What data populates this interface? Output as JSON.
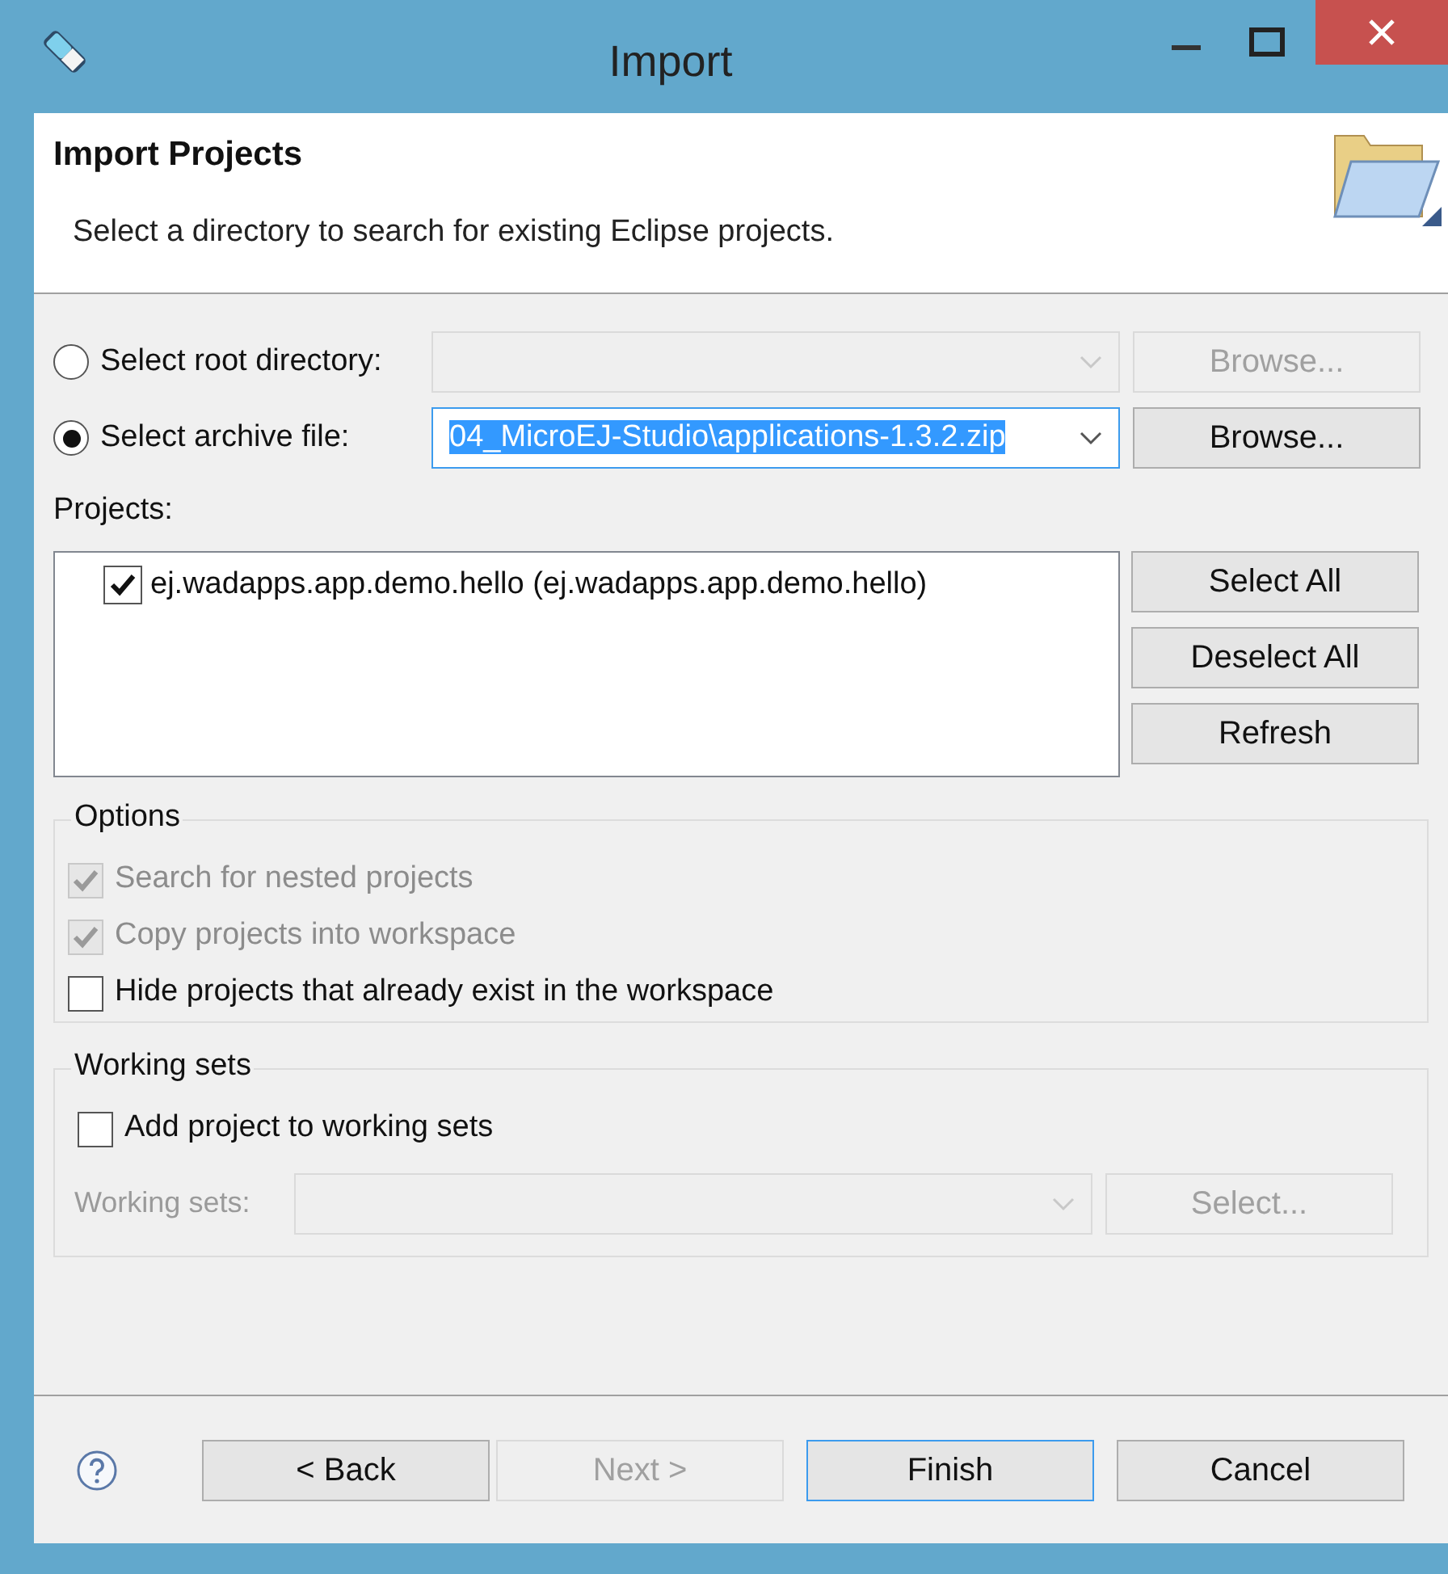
{
  "window": {
    "title": "Import"
  },
  "header": {
    "title": "Import Projects",
    "description": "Select a directory to search for existing Eclipse projects."
  },
  "source_options": [
    {
      "label": "Select root directory:",
      "selected": false,
      "disabled": true,
      "browse": {
        "label": "Browse...",
        "disabled": true
      }
    },
    {
      "label": "Select archive file:",
      "selected": true,
      "value": "04_MicroEJ-Studio\\applications-1.3.2.zip",
      "disabled": false,
      "browse": {
        "label": "Browse...",
        "disabled": false
      }
    }
  ],
  "projects": {
    "label": "Projects:",
    "items": [
      {
        "label": "ej.wadapps.app.demo.hello (ej.wadapps.app.demo.hello)",
        "checked": true
      }
    ],
    "buttons": [
      "Select All",
      "Deselect All",
      "Refresh"
    ]
  },
  "options": {
    "title": "Options",
    "items": [
      {
        "label": "Search for nested projects",
        "checked": true,
        "disabled": true
      },
      {
        "label": "Copy projects into workspace",
        "checked": true,
        "disabled": true
      },
      {
        "label": "Hide projects that already exist in the workspace",
        "checked": false,
        "disabled": false
      }
    ]
  },
  "working_sets": {
    "title": "Working sets",
    "checkbox": {
      "label": "Add project to working sets",
      "checked": false
    },
    "field": {
      "label": "Working sets:",
      "disabled": true
    },
    "button": {
      "label": "Select...",
      "disabled": true
    }
  },
  "footer": {
    "buttons": [
      {
        "label": "< Back",
        "disabled": false,
        "default": false
      },
      {
        "label": "Next >",
        "disabled": true,
        "default": false
      },
      {
        "label": "Finish",
        "disabled": false,
        "default": true
      },
      {
        "label": "Cancel",
        "disabled": false,
        "default": false
      }
    ]
  }
}
